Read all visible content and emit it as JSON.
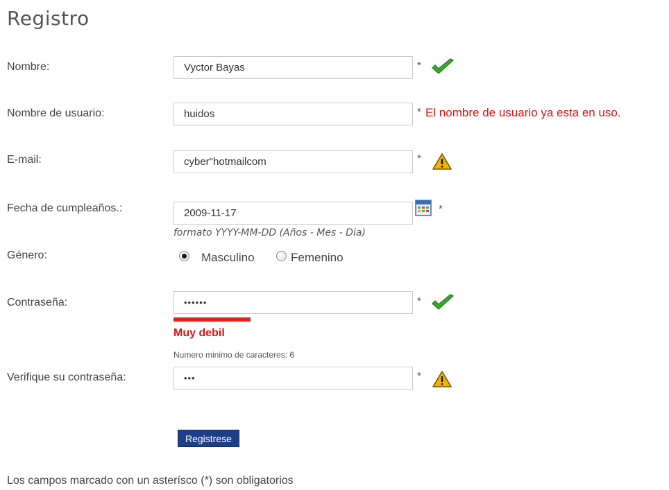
{
  "page": {
    "title": "Registro"
  },
  "form": {
    "name": {
      "label": "Nombre:",
      "value": "Vyctor Bayas",
      "required": "*"
    },
    "username": {
      "label": "Nombre de usuario:",
      "value": "huidos",
      "required": "*",
      "error": "El nombre de usuario ya esta en uso."
    },
    "email": {
      "label": "E-mail:",
      "value": "cyber\"hotmailcom",
      "required": "*"
    },
    "birthdate": {
      "label": "Fecha de cumpleaños.:",
      "value": "2009-11-17",
      "required": "*",
      "hint": "formato YYYY-MM-DD (Años - Mes - Dia)"
    },
    "gender": {
      "label": "Género:",
      "options": [
        "Masculino",
        "Femenino"
      ],
      "selected": "Masculino"
    },
    "password": {
      "label": "Contraseña:",
      "value": "••••••",
      "required": "*",
      "strength_label": "Muy debil",
      "strength_level": 0.2,
      "min_chars_note": "Numero minimo de caracteres: 6"
    },
    "password_confirm": {
      "label": "Verifique su contraseña:",
      "value": "•••",
      "required": "*"
    },
    "submit_label": "Registrese"
  },
  "footer": {
    "note": "Los campos marcado con un asterísco (*) son obligatorios"
  },
  "icons": {
    "valid": "check-icon",
    "warning": "warning-icon",
    "calendar": "calendar-icon"
  },
  "colors": {
    "error": "#e01010",
    "strength_bar": "#e31f1f",
    "button": "#1d3f88",
    "check": "#3aa82a",
    "warning": "#f2b400"
  }
}
